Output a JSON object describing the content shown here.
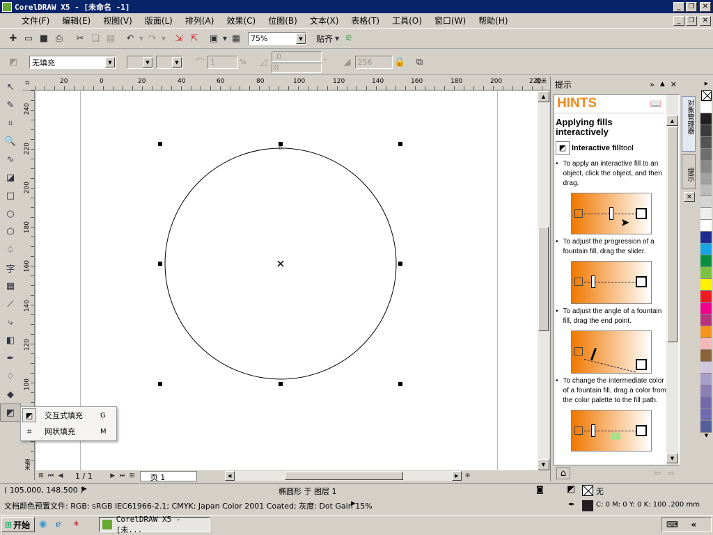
{
  "window": {
    "title": "CorelDRAW X5 - [未命名 -1]"
  },
  "menu": [
    "文件(F)",
    "编辑(E)",
    "视图(V)",
    "版面(L)",
    "排列(A)",
    "效果(C)",
    "位图(B)",
    "文本(X)",
    "表格(T)",
    "工具(O)",
    "窗口(W)",
    "帮助(H)"
  ],
  "toolbar": {
    "zoom": "75%",
    "snap_label": "贴齐"
  },
  "propbar": {
    "fill_type": "无填充",
    "midpoint": "1",
    "angle1": ".0",
    "angle2": "0",
    "steps": "256"
  },
  "ruler": {
    "h_ticks": [
      "20",
      "0",
      "20",
      "40",
      "60",
      "80",
      "100",
      "120",
      "140",
      "160",
      "180",
      "200",
      "220"
    ],
    "v_ticks": [
      "240",
      "220",
      "200",
      "180",
      "160",
      "140",
      "120",
      "100"
    ],
    "unit_x": "毫米",
    "unit_y": "毫米"
  },
  "flyout": {
    "items": [
      {
        "label": "交互式填充",
        "key": "G",
        "icon": "interactive-fill-icon"
      },
      {
        "label": "网状填充",
        "key": "M",
        "icon": "mesh-fill-icon"
      }
    ]
  },
  "pagenav": {
    "page_count": "1 / 1",
    "page_tab": "页 1"
  },
  "hints": {
    "docker_title": "提示",
    "heading": "HINTS",
    "subtitle": "Applying fills interactively",
    "tool_bold": "Interactive fill",
    "tool_rest": " tool",
    "items": [
      "To apply an interactive fill to an object, click the object, and then drag.",
      "To adjust the progression of a fountain fill, drag the slider.",
      "To adjust the angle of a fountain fill, drag the end point.",
      "To change the intermediate color of a fountain fill, drag a color from the color palette to the fill path."
    ],
    "side_tabs": [
      "对象管理器",
      "提示"
    ]
  },
  "status": {
    "coords": "( 105.000, 148.500 )",
    "object_info": "椭圆形 于 图层 1",
    "profile": "文档颜色预置文件: RGB: sRGB IEC61966-2.1; CMYK: Japan Color 2001 Coated; 灰度: Dot Gain 15%",
    "fill_label": "无",
    "outline_info": "C: 0 M: 0 Y: 0 K: 100  .200 mm"
  },
  "taskbar": {
    "start": "开始",
    "task": "CorelDRAW X5 - [未..."
  },
  "colors": {
    "title_bg": "#0a246a",
    "hints_orange": "#f08a1c"
  },
  "palette": [
    "#ffffff",
    "#231f20",
    "#3c3c3c",
    "#555555",
    "#6e6e6e",
    "#888888",
    "#a1a1a1",
    "#bbbbbb",
    "#d4d4d4",
    "#eeeeee",
    "#ffffff",
    "#1e2b8f",
    "#1aa3e0",
    "#0a8f3e",
    "#7cc242",
    "#fff100",
    "#ed1c24",
    "#ec008c",
    "#b5327e",
    "#f7941d",
    "#f4b6b6",
    "#8c6239",
    "#d1c6e0",
    "#a89fc9",
    "#8c7fb5",
    "#7469a8",
    "#6f6baf",
    "#55609b"
  ]
}
